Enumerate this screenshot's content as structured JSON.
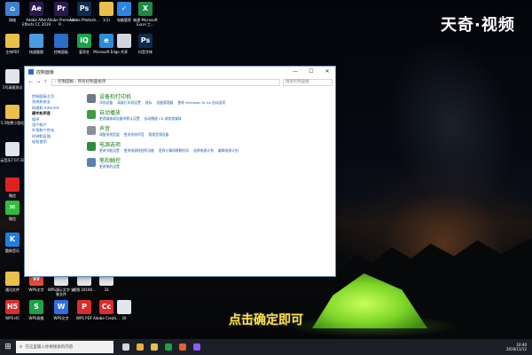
{
  "watermark": "天奇·视频",
  "subtitle": "点击确定即可",
  "desktop_icons": [
    {
      "label": "网络",
      "icon": "network-icon",
      "color": "#3f7fd0",
      "glyph": "⌂"
    },
    {
      "label": "Adobe After Effects CC 2019",
      "icon": "after-effects-icon",
      "color": "#2a1b4f",
      "glyph": "Ae"
    },
    {
      "label": "Adobe Premiere P...",
      "icon": "premiere-icon",
      "color": "#2a1b4f",
      "glyph": "Pr"
    },
    {
      "label": "Adobe Photosh...",
      "icon": "photoshop-icon",
      "color": "#0d2c4f",
      "glyph": "Ps"
    },
    {
      "label": "1(1)",
      "icon": "folder-icon",
      "color": "#e8c04a",
      "glyph": ""
    },
    {
      "label": "电脑管家",
      "icon": "pc-manager-icon",
      "color": "#2f84e0",
      "glyph": "✓"
    },
    {
      "label": "新建 Microsoft Excel 工...",
      "icon": "excel-icon",
      "color": "#1e8b44",
      "glyph": "X"
    },
    {
      "label": "主持PDF",
      "icon": "folder-icon",
      "color": "#e8c04a",
      "glyph": ""
    },
    {
      "label": "快速截图",
      "icon": "screenshot-icon",
      "color": "#4a9ae0",
      "glyph": ""
    },
    {
      "label": "控制面板",
      "icon": "control-panel-icon",
      "color": "#2b6cc7",
      "glyph": ""
    },
    {
      "label": "爱奇艺",
      "icon": "iqiyi-icon",
      "color": "#1ea14a",
      "glyph": "iQ"
    },
    {
      "label": "Microsoft Edge",
      "icon": "edge-icon",
      "color": "#2e8bd8",
      "glyph": "e"
    },
    {
      "label": "共享",
      "icon": "share-icon",
      "color": "#cfd6e0",
      "glyph": ""
    },
    {
      "label": "抖音字体",
      "icon": "photoshop-icon",
      "color": "#0d2c4f",
      "glyph": "Ps"
    },
    {
      "label": "1号清理测试",
      "icon": "file-icon",
      "color": "#dfe6ee",
      "glyph": ""
    },
    {
      "label": "5.5免费小游戏",
      "icon": "folder-icon",
      "color": "#e8c04a",
      "glyph": ""
    },
    {
      "label": "云音乐7.07.38",
      "icon": "music-file-icon",
      "color": "#dfe6ee",
      "glyph": ""
    },
    {
      "label": "微信",
      "icon": "app-icon",
      "color": "#d22",
      "glyph": ""
    },
    {
      "label": "微信",
      "icon": "wechat-icon",
      "color": "#2fbf3f",
      "glyph": "✉"
    },
    {
      "label": "酷狗音乐",
      "icon": "kugou-icon",
      "color": "#1f7fe0",
      "glyph": "K"
    },
    {
      "label": "通讯文件",
      "icon": "file-icon",
      "color": "#e8c04a",
      "glyph": ""
    },
    {
      "label": "WPS文字",
      "icon": "wps-writer-icon",
      "color": "#e84a3c",
      "glyph": "W"
    },
    {
      "label": "WPS演示文字 安装文件",
      "icon": "file-icon",
      "color": "#dfe6ee",
      "glyph": ""
    },
    {
      "label": "视频 20190...",
      "icon": "video-file-icon",
      "color": "#dfe6ee",
      "glyph": ""
    },
    {
      "label": "33",
      "icon": "file-icon",
      "color": "#dfe6ee",
      "glyph": ""
    },
    {
      "label": "WPS H5",
      "icon": "wps-h5-icon",
      "color": "#d92e2e",
      "glyph": "H5"
    },
    {
      "label": "WPS表格",
      "icon": "wps-sheet-icon",
      "color": "#1ea14a",
      "glyph": "S"
    },
    {
      "label": "WPS文字",
      "icon": "wps-writer-icon",
      "color": "#2f6fe0",
      "glyph": "W"
    },
    {
      "label": "WPS PDF",
      "icon": "wps-pdf-icon",
      "color": "#d92e2e",
      "glyph": "P"
    },
    {
      "label": "Adobe Creati...",
      "icon": "adobe-icon",
      "color": "#d92e2e",
      "glyph": "Cc"
    },
    {
      "label": "20",
      "icon": "file-icon",
      "color": "#dfe6ee",
      "glyph": ""
    }
  ],
  "window": {
    "title": "控制面板",
    "minimize": "—",
    "maximize": "☐",
    "close": "✕",
    "path": "› 控制面板 › 所有控制面板项",
    "search_placeholder": "搜索控制面板",
    "left_nav": [
      "控制面板主页",
      "系统和安全",
      "网络和 Internet",
      "硬件和声音",
      "程序",
      "用户帐户",
      "外观和个性化",
      "时钟和区域",
      "轻松使用"
    ],
    "left_nav_current_index": 3,
    "categories": [
      {
        "title": "设备和打印机",
        "icon": "printer-icon",
        "color": "#6b7a8a",
        "links": [
          "添加设备",
          "高级打印机设置",
          "鼠标",
          "设备管理器",
          "更改 Windows To Go 启动选项"
        ]
      },
      {
        "title": "自动播放",
        "icon": "autoplay-icon",
        "color": "#3e9b3e",
        "links": [
          "更改媒体或设备的默认设置",
          "自动播放 CD 或其他媒体"
        ]
      },
      {
        "title": "声音",
        "icon": "sound-icon",
        "color": "#8b8f97",
        "links": [
          "调整系统音量",
          "更改系统声音",
          "管理音频设备"
        ]
      },
      {
        "title": "电源选项",
        "icon": "power-icon",
        "color": "#2f8a3e",
        "links": [
          "更改节能设置",
          "更改电源按钮的功能",
          "更改计算机睡眠时间",
          "选择电源计划",
          "编辑电源计划"
        ]
      },
      {
        "title": "笔和触控",
        "icon": "pen-icon",
        "color": "#5b7fb0",
        "links": [
          "更改笔的设置"
        ]
      }
    ]
  },
  "taskbar": {
    "start": "⊞",
    "search_placeholder": "在这里输入你要搜索的内容",
    "apps": [
      {
        "icon": "task-view-icon",
        "color": "#cfd6e0"
      },
      {
        "icon": "chrome-icon",
        "color": "#e0b43a"
      },
      {
        "icon": "folder-icon",
        "color": "#e8c04a"
      },
      {
        "icon": "wps-icon",
        "color": "#1ea14a"
      },
      {
        "icon": "app-icon",
        "color": "#e2632b"
      },
      {
        "icon": "video-app-icon",
        "color": "#8b5cf6"
      }
    ],
    "time": "10:40",
    "date": "2019/11/12"
  }
}
